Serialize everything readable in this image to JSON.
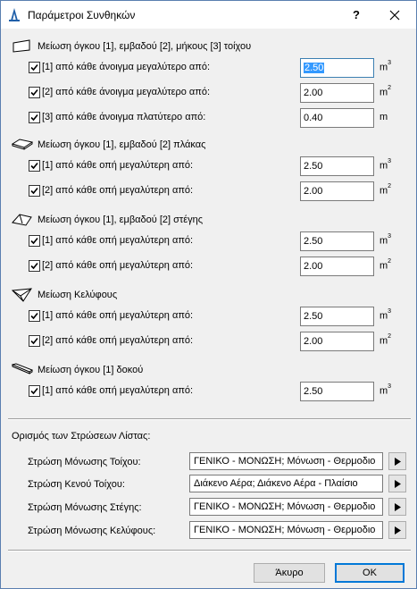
{
  "window": {
    "title": "Παράμετροι Συνθηκών",
    "help": "?"
  },
  "sections": [
    {
      "icon": "wall-icon",
      "label": "Μείωση όγκου [1], εμβαδού [2], μήκους [3] τοίχου",
      "rows": [
        {
          "label": "[1] από κάθε άνοιγμα μεγαλύτερο από:",
          "value": "2.50",
          "unit": "m",
          "exp": "3",
          "checked": true,
          "focused": true
        },
        {
          "label": "[2] από κάθε άνοιγμα μεγαλύτερο από:",
          "value": "2.00",
          "unit": "m",
          "exp": "2",
          "checked": true
        },
        {
          "label": "[3] από κάθε άνοιγμα πλατύτερο από:",
          "value": "0.40",
          "unit": "m",
          "exp": "",
          "checked": true
        }
      ]
    },
    {
      "icon": "slab-icon",
      "label": "Μείωση όγκου [1], εμβαδού [2] πλάκας",
      "rows": [
        {
          "label": "[1] από κάθε οπή μεγαλύτερη από:",
          "value": "2.50",
          "unit": "m",
          "exp": "3",
          "checked": true
        },
        {
          "label": "[2] από κάθε οπή μεγαλύτερη από:",
          "value": "2.00",
          "unit": "m",
          "exp": "2",
          "checked": true
        }
      ]
    },
    {
      "icon": "roof-icon",
      "label": "Μείωση όγκου [1], εμβαδού [2] στέγης",
      "rows": [
        {
          "label": "[1] από κάθε οπή μεγαλύτερη από:",
          "value": "2.50",
          "unit": "m",
          "exp": "3",
          "checked": true
        },
        {
          "label": "[2] από κάθε οπή μεγαλύτερη από:",
          "value": "2.00",
          "unit": "m",
          "exp": "2",
          "checked": true
        }
      ]
    },
    {
      "icon": "shell-icon",
      "label": "Μείωση Κελύφους",
      "rows": [
        {
          "label": "[1] από κάθε οπή μεγαλύτερη από:",
          "value": "2.50",
          "unit": "m",
          "exp": "3",
          "checked": true
        },
        {
          "label": "[2] από κάθε οπή μεγαλύτερη από:",
          "value": "2.00",
          "unit": "m",
          "exp": "2",
          "checked": true
        }
      ]
    },
    {
      "icon": "beam-icon",
      "label": "Μείωση όγκου [1] δοκού",
      "rows": [
        {
          "label": "[1] από κάθε οπή μεγαλύτερη από:",
          "value": "2.50",
          "unit": "m",
          "exp": "3",
          "checked": true
        }
      ]
    }
  ],
  "list_layers": {
    "title": "Ορισμός των Στρώσεων Λίστας:",
    "rows": [
      {
        "label": "Στρώση Μόνωσης Τοίχου:",
        "value": "ΓΕΝΙΚΟ - ΜΟΝΩΣΗ; Μόνωση - Θερμοδιο"
      },
      {
        "label": "Στρώση Κενού Τοίχου:",
        "value": "Διάκενο Αέρα; Διάκενο Αέρα - Πλαίσιο"
      },
      {
        "label": "Στρώση Μόνωσης Στέγης:",
        "value": "ΓΕΝΙΚΟ - ΜΟΝΩΣΗ; Μόνωση - Θερμοδιο"
      },
      {
        "label": "Στρώση Μόνωσης Κελύφους:",
        "value": "ΓΕΝΙΚΟ - ΜΟΝΩΣΗ; Μόνωση - Θερμοδιο"
      }
    ]
  },
  "buttons": {
    "cancel": "Άκυρο",
    "ok": "OK"
  }
}
